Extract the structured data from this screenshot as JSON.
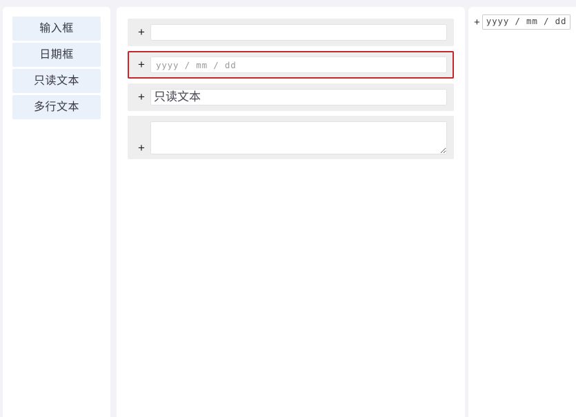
{
  "theme": {
    "page_background": "#f3f3f7",
    "panel_background": "#ffffff",
    "sidebar_item_background": "#eaf1fa",
    "row_background": "#eeeeef",
    "selection_border": "#c1272d",
    "field_border": "#e2e2e4",
    "placeholder_color": "#9a9a9a"
  },
  "sidebar": {
    "items": [
      {
        "label": "输入框",
        "name": "sidebar-item-text-input"
      },
      {
        "label": "日期框",
        "name": "sidebar-item-date-input"
      },
      {
        "label": "只读文本",
        "name": "sidebar-item-readonly-text"
      },
      {
        "label": "多行文本",
        "name": "sidebar-item-multiline-text"
      }
    ]
  },
  "canvas": {
    "rows": [
      {
        "type": "text",
        "handle": "+",
        "value": "",
        "placeholder": "",
        "selected": false
      },
      {
        "type": "date",
        "handle": "+",
        "value": "",
        "placeholder": "yyyy / mm / dd",
        "selected": true
      },
      {
        "type": "readonly",
        "handle": "+",
        "value": "只读文本",
        "placeholder": "",
        "selected": false
      },
      {
        "type": "textarea",
        "handle": "+",
        "value": "",
        "placeholder": "",
        "selected": false
      }
    ]
  },
  "properties_panel": {
    "drag_ghost": {
      "handle": "+",
      "label": "yyyy / mm / dd"
    }
  }
}
